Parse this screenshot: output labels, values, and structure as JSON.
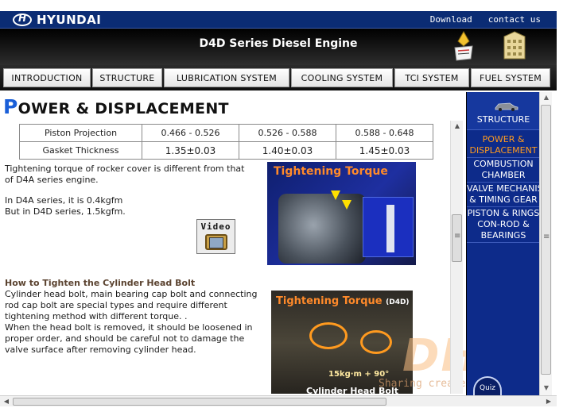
{
  "brand": {
    "logo_text": "HYUNDAI",
    "color_top": "#0b2c74"
  },
  "top_links": {
    "download": "Download",
    "contact": "contact us"
  },
  "header": {
    "title": "D4D Series Diesel Engine"
  },
  "nav": {
    "tabs": [
      "INTRODUCTION",
      "STRUCTURE",
      "LUBRICATION SYSTEM",
      "COOLING SYSTEM",
      "TCI SYSTEM",
      "FUEL SYSTEM"
    ]
  },
  "content": {
    "title_first": "P",
    "title_rest": "OWER & DISPLACEMENT",
    "spec_table": {
      "rows": [
        {
          "label": "Piston Projection",
          "values": [
            "0.466 - 0.526",
            "0.526 - 0.588",
            "0.588 - 0.648"
          ]
        },
        {
          "label": "Gasket Thickness",
          "values": [
            "1.35±0.03",
            "1.40±0.03",
            "1.45±0.03"
          ]
        }
      ]
    },
    "torque_text": {
      "line1": "Tightening torque of rocker cover is different from that",
      "line2": "of D4A series engine.",
      "line3": "In D4A series, it is 0.4kgfm",
      "line4": "But in D4D series, 1.5kgfm."
    },
    "video_button": {
      "label": "Video",
      "icon": "tv-icon"
    },
    "photo1": {
      "title": "Tightening Torque"
    },
    "section_head": "How to Tighten the Cylinder Head Bolt",
    "head_bolt_text": {
      "line1": "Cylinder head bolt, main bearing cap bolt and connecting",
      "line2": "rod cap bolt are special types and require different",
      "line3": "tightening method with different torque. .",
      "line4": "When the head bolt is removed, it should be loosened in",
      "line5": "proper order, and should be careful not to damage the",
      "line6": "valve surface after removing cylinder head."
    },
    "photo2": {
      "title": "Tightening Torque",
      "title_suffix": "(D4D)",
      "label": "15kg·m + 90°",
      "caption": "Cylinder Head Bolt"
    },
    "watermark": {
      "letters": "DHT",
      "tagline": "Sharing creates success"
    }
  },
  "sidebar": {
    "header_label": "STRUCTURE",
    "header_icon": "car-icon",
    "accent_color": "#ff9b1f",
    "items": [
      {
        "line1": "POWER &",
        "line2": "DISPLACEMENT",
        "active": true
      },
      {
        "line1": "COMBUSTION",
        "line2": "CHAMBER",
        "active": false
      },
      {
        "line1": "VALVE MECHANISM",
        "line2": "& TIMING GEAR",
        "active": false
      },
      {
        "line1": "PISTON & RINGS",
        "line2": "CON-ROD &",
        "line3": "BEARINGS",
        "active": false
      }
    ],
    "quiz_label": "Quiz"
  }
}
